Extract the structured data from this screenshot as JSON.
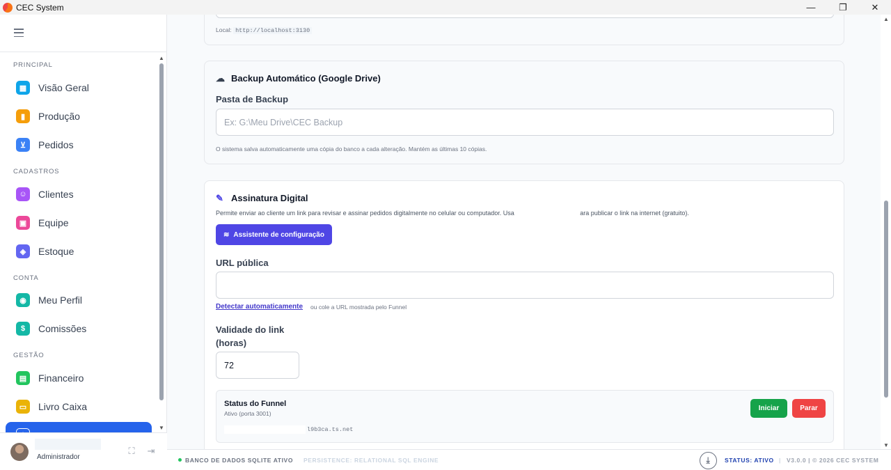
{
  "window": {
    "title": "CEC System",
    "controls": {
      "minimize": "—",
      "maximize": "❐",
      "close": "✕"
    }
  },
  "sidebar": {
    "sections": [
      {
        "label": "PRINCIPAL",
        "items": [
          {
            "label": "Visão Geral",
            "icon": "grid-icon",
            "color": "#0ea5e9"
          },
          {
            "label": "Produção",
            "icon": "factory-icon",
            "color": "#f59e0b"
          },
          {
            "label": "Pedidos",
            "icon": "cart-icon",
            "color": "#3b82f6"
          }
        ]
      },
      {
        "label": "CADASTROS",
        "items": [
          {
            "label": "Clientes",
            "icon": "users-icon",
            "color": "#a855f7"
          },
          {
            "label": "Equipe",
            "icon": "briefcase-icon",
            "color": "#ec4899"
          },
          {
            "label": "Estoque",
            "icon": "box-icon",
            "color": "#6366f1"
          }
        ]
      },
      {
        "label": "CONTA",
        "items": [
          {
            "label": "Meu Perfil",
            "icon": "user-icon",
            "color": "#14b8a6"
          },
          {
            "label": "Comissões",
            "icon": "dollar-icon",
            "color": "#14b8a6"
          }
        ]
      },
      {
        "label": "GESTÃO",
        "items": [
          {
            "label": "Financeiro",
            "icon": "document-icon",
            "color": "#22c55e"
          },
          {
            "label": "Livro Caixa",
            "icon": "wallet-icon",
            "color": "#eab308"
          }
        ]
      }
    ],
    "active_item_color": "#2563eb",
    "user": {
      "role": "Administrador"
    }
  },
  "main": {
    "server_card": {
      "local_label": "Local:",
      "local_url": "http://localhost:3130"
    },
    "backup_card": {
      "title": "Backup Automático (Google Drive)",
      "folder_label": "Pasta de Backup",
      "folder_placeholder": "Ex: G:\\Meu Drive\\CEC Backup",
      "hint": "O sistema salva automaticamente uma cópia do banco a cada alteração. Mantém as últimas 10 cópias."
    },
    "signature_card": {
      "title": "Assinatura Digital",
      "description_start": "Permite enviar ao cliente um link para revisar e assinar pedidos digitalmente no celular ou computador. Usa",
      "description_end": "ara publicar o link na internet (gratuito).",
      "wizard_button": "Assistente de configuração",
      "url_label": "URL pública",
      "url_value": "",
      "detect_link": "Detectar automaticamente",
      "detect_hint": "ou cole a URL mostrada pelo Funnel",
      "validity_label_line1": "Validade do link",
      "validity_label_line2": "(horas)",
      "validity_value": "72",
      "funnel": {
        "title": "Status do Funnel",
        "status": "Ativo (porta 3001)",
        "url_suffix": "l9b3ca.ts.net",
        "start_button": "Iniciar",
        "stop_button": "Parar"
      }
    }
  },
  "footer": {
    "db_status": "BANCO DE DADOS SQLITE ATIVO",
    "persistence": "PERSISTENCE: RELATIONAL SQL ENGINE",
    "status": "STATUS: ATIVO",
    "separator": "|",
    "version": "V3.0.0 | © 2026 CEC SYSTEM"
  }
}
